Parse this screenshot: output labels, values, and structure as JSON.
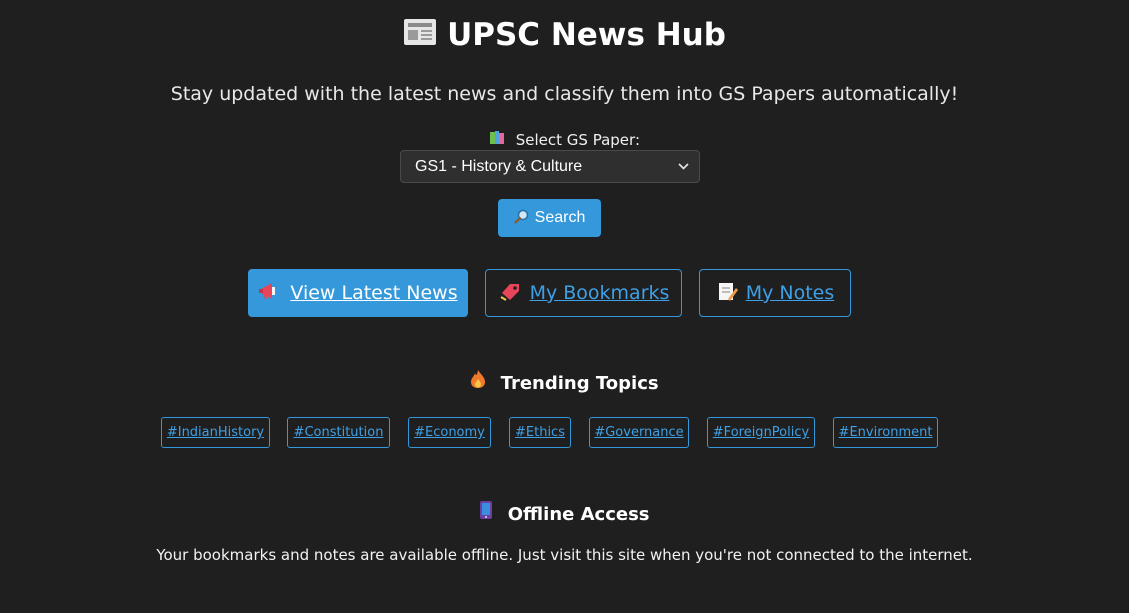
{
  "header": {
    "icon": "newspaper-icon",
    "title": "UPSC News Hub",
    "subtitle": "Stay updated with the latest news and classify them into GS Papers automatically!"
  },
  "selector": {
    "icon": "books-icon",
    "label": "Select GS Paper:",
    "selected": "GS1 - History & Culture"
  },
  "search": {
    "icon": "magnifier-icon",
    "label": "Search"
  },
  "nav": {
    "latest": {
      "icon": "megaphone-icon",
      "label": "View Latest News"
    },
    "bookmarks": {
      "icon": "bookmark-icon",
      "label": "My Bookmarks"
    },
    "notes": {
      "icon": "memo-icon",
      "label": "My Notes"
    }
  },
  "trending": {
    "icon": "fire-icon",
    "title": "Trending Topics",
    "tags": [
      "#IndianHistory",
      "#Constitution",
      "#Economy",
      "#Ethics",
      "#Governance",
      "#ForeignPolicy",
      "#Environment"
    ]
  },
  "offline": {
    "icon": "mobile-phone-icon",
    "title": "Offline Access",
    "text": "Your bookmarks and notes are available offline. Just visit this site when you're not connected to the internet."
  },
  "colors": {
    "background": "#1f1f1f",
    "accent": "#3498db",
    "link": "#3ea0e6"
  }
}
